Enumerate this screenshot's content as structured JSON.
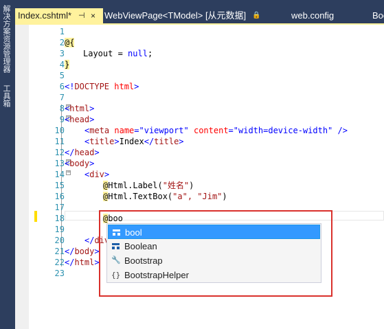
{
  "left_panel": {
    "solution_explorer_label": "解决方案资源管理器",
    "toolbox_label": "工具箱"
  },
  "tabs": {
    "active": {
      "label": "Index.cshtml*",
      "pin": "⊣",
      "close": "×"
    },
    "second": {
      "label": "WebViewPage<TModel> [从元数据]",
      "lock_icon": "lock-icon"
    },
    "third": {
      "label": "web.config"
    },
    "fourth": {
      "label": "Boo"
    }
  },
  "editor": {
    "line_numbers": [
      "1",
      "2",
      "3",
      "4",
      "5",
      "6",
      "7",
      "8",
      "9",
      "10",
      "11",
      "12",
      "13",
      "14",
      "15",
      "16",
      "17",
      "18",
      "19",
      "20",
      "21",
      "22",
      "23"
    ],
    "lines": {
      "l2": {
        "razor": "@{"
      },
      "l3": {
        "text1": "Layout = ",
        "kw": "null",
        "text2": ";"
      },
      "l4": {
        "razor": "}"
      },
      "l6": {
        "delim1": "<!",
        "tag": "DOCTYPE",
        "attr": " html",
        "delim2": ">"
      },
      "l8": {
        "open": "<",
        "tag": "html",
        "close": ">"
      },
      "l9": {
        "open": "<",
        "tag": "head",
        "close": ">"
      },
      "l10": {
        "open": "<",
        "tag": "meta",
        "a1": " name",
        "eq1": "=",
        "v1": "\"viewport\"",
        "a2": " content",
        "eq2": "=",
        "v2": "\"width=device-width\"",
        "close": " />"
      },
      "l11": {
        "open": "<",
        "tag": "title",
        "close": ">",
        "text": "Index",
        "open2": "</",
        "tag2": "title",
        "close2": ">"
      },
      "l12": {
        "open": "</",
        "tag": "head",
        "close": ">"
      },
      "l13": {
        "open": "<",
        "tag": "body",
        "close": ">"
      },
      "l14": {
        "open": "<",
        "tag": "div",
        "close": ">"
      },
      "l15": {
        "at": "@",
        "text": "Html.Label(",
        "str": "\"姓名\"",
        "text2": ")"
      },
      "l16": {
        "at": "@",
        "text": "Html.TextBox(",
        "str": "\"a\", \"Jim\"",
        "text2": ")"
      },
      "l18": {
        "at": "@",
        "typed": "boo"
      },
      "l20": {
        "open": "</",
        "tag": "div"
      },
      "l21": {
        "open": "</",
        "tag": "body",
        "close": ">"
      },
      "l22": {
        "open": "</",
        "tag": "html",
        "close": ">"
      }
    }
  },
  "completion_list": {
    "items": [
      {
        "label": "bool",
        "icon": "struct-icon",
        "selected": true
      },
      {
        "label": "Boolean",
        "icon": "struct-icon",
        "selected": false
      },
      {
        "label": "Bootstrap",
        "icon": "wrench-icon",
        "selected": false
      },
      {
        "label": "BootstrapHelper",
        "icon": "namespace-icon",
        "selected": false
      }
    ]
  },
  "colors": {
    "chrome": "#2d3e5e",
    "active_tab": "#fff29d",
    "line_number": "#2b91af",
    "tag": "#a31515",
    "attribute": "#ff0000",
    "string": "#0000ff",
    "selection": "#3399ff",
    "highlight_frame": "#d9302b"
  }
}
